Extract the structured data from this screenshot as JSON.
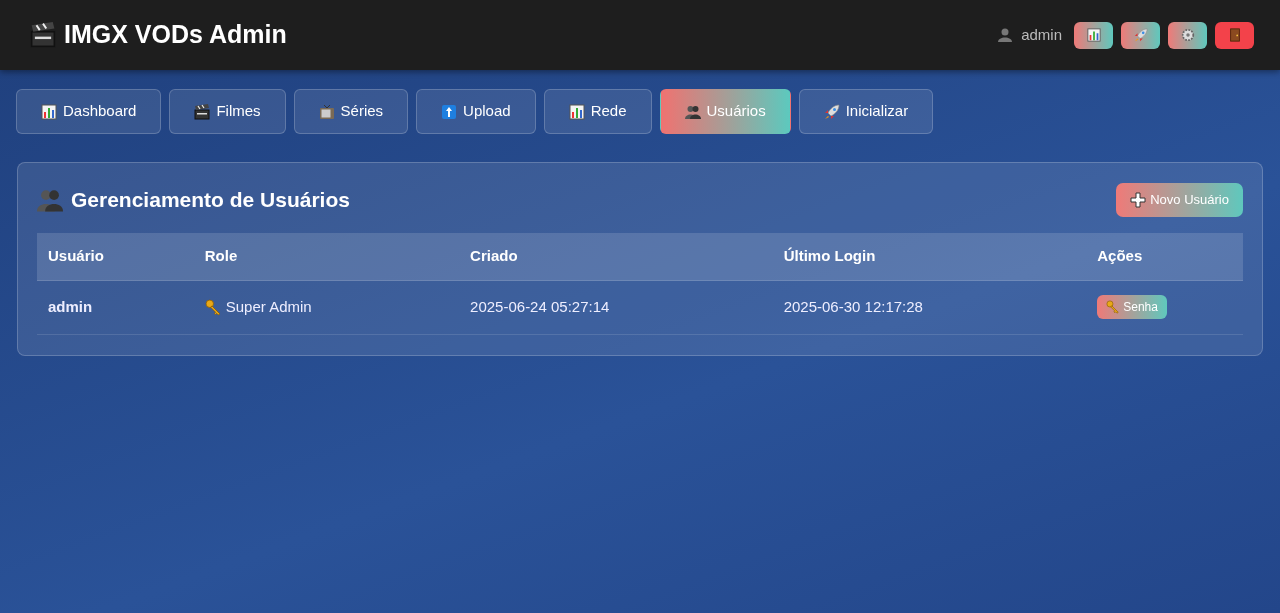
{
  "header": {
    "title": "IMGX VODs Admin",
    "user": "admin",
    "actions": [
      {
        "kind": "stats"
      },
      {
        "kind": "init"
      },
      {
        "kind": "settings"
      },
      {
        "kind": "logout"
      }
    ]
  },
  "tabs": [
    {
      "label": "Dashboard",
      "selected": false
    },
    {
      "label": "Filmes",
      "selected": false
    },
    {
      "label": "Séries",
      "selected": false
    },
    {
      "label": "Upload",
      "selected": false
    },
    {
      "label": "Rede",
      "selected": false
    },
    {
      "label": "Usuários",
      "selected": true
    },
    {
      "label": "Inicializar",
      "selected": false
    }
  ],
  "panel": {
    "title": "Gerenciamento de Usuários",
    "new_button": "Novo Usuário",
    "table": {
      "columns": [
        "Usuário",
        "Role",
        "Criado",
        "Último Login",
        "Ações"
      ],
      "rows": [
        {
          "user": "admin",
          "role": "Super Admin",
          "created": "2025-06-24 05:27:14",
          "last_login": "2025-06-30 12:17:28",
          "action": "Senha"
        }
      ]
    }
  }
}
